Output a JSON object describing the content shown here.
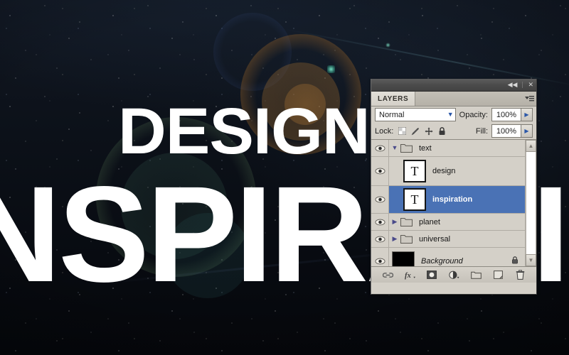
{
  "canvas": {
    "headline_top": "DESIGN",
    "headline_bottom": "INSPIRATION",
    "text_color": "#ffffff",
    "background_color": "#0a0d14"
  },
  "layers_panel": {
    "titlebar": {
      "collapse_icon": "collapse-double-arrow",
      "collapse_glyph": "◀◀",
      "close_icon": "close-x",
      "close_glyph": "✕"
    },
    "tab": {
      "label": "LAYERS",
      "menu_icon": "panel-menu-icon"
    },
    "blend": {
      "label": "",
      "mode": "Normal",
      "opacity_label": "Opacity:",
      "opacity_value": "100%"
    },
    "lock": {
      "label": "Lock:",
      "icons": [
        "lock-transparency-icon",
        "lock-image-icon",
        "lock-position-icon",
        "lock-all-icon"
      ],
      "fill_label": "Fill:",
      "fill_value": "100%"
    },
    "layers": [
      {
        "name": "text",
        "type": "group",
        "visible": true,
        "expanded": true,
        "selected": false,
        "thumb": "folder",
        "locked": false
      },
      {
        "name": "design",
        "type": "type",
        "visible": true,
        "expanded": false,
        "selected": false,
        "thumb": "T",
        "locked": false
      },
      {
        "name": "inspiration",
        "type": "type",
        "visible": true,
        "expanded": false,
        "selected": true,
        "thumb": "T",
        "locked": false
      },
      {
        "name": "planet",
        "type": "group",
        "visible": true,
        "expanded": false,
        "selected": false,
        "thumb": "folder",
        "locked": false
      },
      {
        "name": "universal",
        "type": "group",
        "visible": true,
        "expanded": false,
        "selected": false,
        "thumb": "folder",
        "locked": false
      },
      {
        "name": "Background",
        "type": "raster",
        "visible": true,
        "expanded": false,
        "selected": false,
        "thumb": "black",
        "locked": true
      }
    ],
    "scrollbar": {
      "up_glyph": "▲",
      "down_glyph": "▼"
    },
    "bottom_bar": {
      "buttons": [
        "link-layers-icon",
        "layer-style-fx-icon",
        "add-layer-mask-icon",
        "new-adjustment-layer-icon",
        "new-group-icon",
        "new-layer-icon",
        "delete-layer-icon"
      ]
    },
    "selection_color": "#4a72b5",
    "panel_color": "#d4d0c8"
  }
}
